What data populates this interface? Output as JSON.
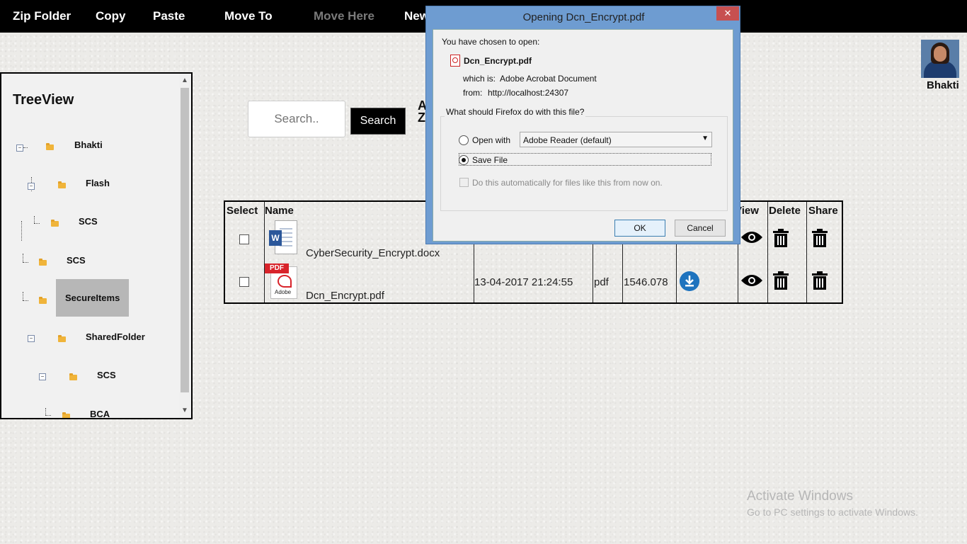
{
  "nav": {
    "zip_folder": "Zip Folder",
    "copy": "Copy",
    "paste": "Paste",
    "move_to": "Move To",
    "move_here": "Move Here",
    "new": "New"
  },
  "user": {
    "name": "Bhakti"
  },
  "tree": {
    "title": "TreeView",
    "items": [
      "Bhakti",
      "Flash",
      "SCS",
      "SCS",
      "SecureItems",
      "SharedFolder",
      "SCS",
      "BCA"
    ]
  },
  "search": {
    "placeholder": "Search..",
    "button": "Search"
  },
  "table": {
    "headers": [
      "Select",
      "Name",
      "View",
      "Delete",
      "Share"
    ],
    "rows": [
      {
        "name": "CyberSecurity_Encrypt.docx",
        "icon": "word-document-icon"
      },
      {
        "name": "Dcn_Encrypt.pdf",
        "icon": "pdf-document-icon",
        "date": "13-04-2017 21:24:55",
        "type": "pdf",
        "size": "1546.078"
      }
    ]
  },
  "dialog": {
    "title": "Opening Dcn_Encrypt.pdf",
    "close": "✕",
    "chosen": "You have chosen to open:",
    "filename": "Dcn_Encrypt.pdf",
    "which_is_label": "which is:",
    "which_is_value": "Adobe Acrobat Document",
    "from_label": "from:",
    "from_value": "http://localhost:24307",
    "question": "What should Firefox do with this file?",
    "open_with": "Open with",
    "app": "Adobe Reader  (default)",
    "save_file": "Save File",
    "auto": "Do this automatically for files like this from now on.",
    "ok": "OK",
    "cancel": "Cancel"
  },
  "watermark": {
    "title": "Activate Windows",
    "subtitle": "Go to PC settings to activate Windows."
  }
}
